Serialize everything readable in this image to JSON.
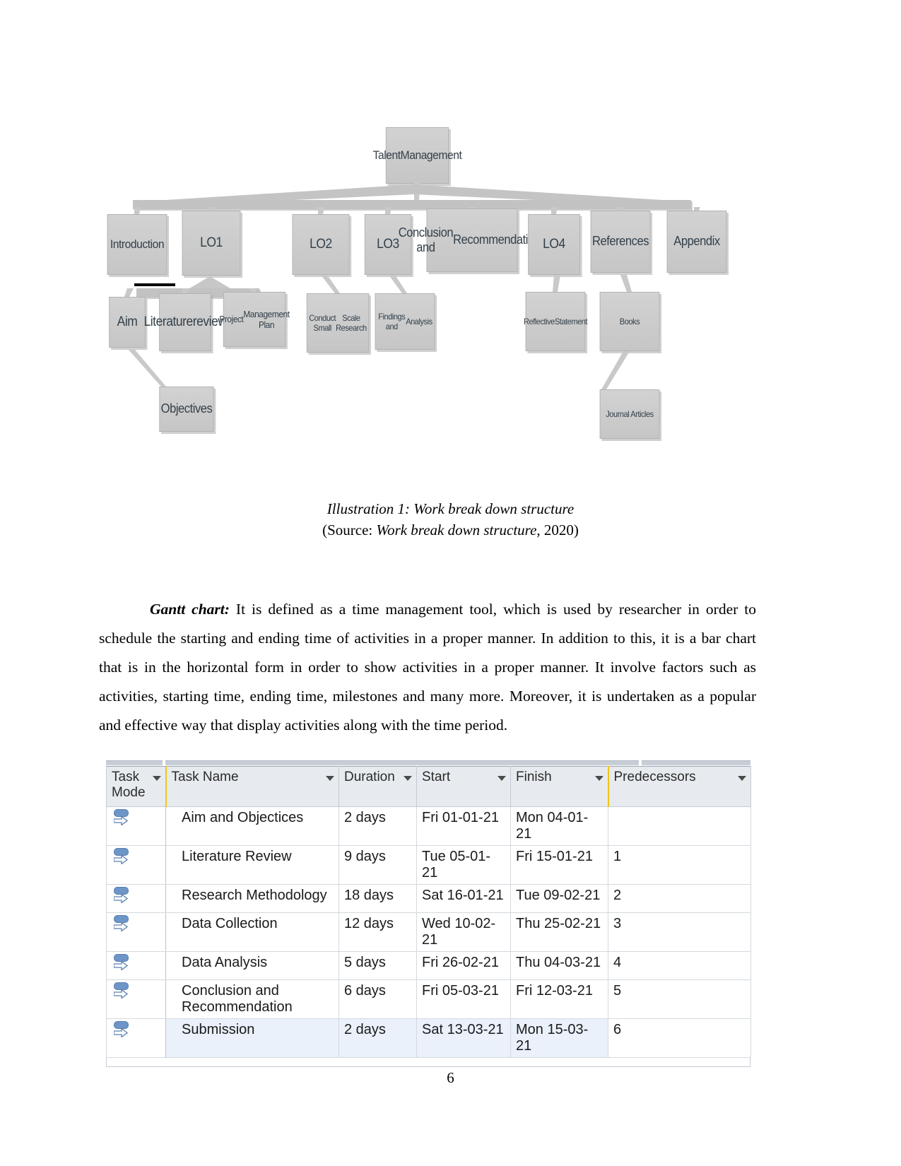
{
  "diagram": {
    "title": "Work break down structure",
    "root": {
      "label": "Talent\nManagement"
    },
    "level1": [
      {
        "label": "Introduction"
      },
      {
        "label": "LO1"
      },
      {
        "label": "LO2"
      },
      {
        "label": "LO3"
      },
      {
        "label": "Conclusion and\nRecommendations"
      },
      {
        "label": "LO4"
      },
      {
        "label": "References"
      },
      {
        "label": "Appendix"
      }
    ],
    "level2": [
      {
        "label": "Aim"
      },
      {
        "label": "Literature\nreview"
      },
      {
        "label": "Project\nManagement Plan"
      },
      {
        "label": "Conduct Small\nScale Research"
      },
      {
        "label": "Findings and\nAnalysis"
      },
      {
        "label": "Reflective\nStatement"
      },
      {
        "label": "Books"
      }
    ],
    "level3": [
      {
        "label": "Objectives"
      },
      {
        "label": "Journal Articles"
      }
    ],
    "node_fill": "#cbcbcb",
    "node_text_color": "#33404a"
  },
  "captions": {
    "illustration": "Illustration 1: Work break down structure",
    "source_prefix": "(Source:  ",
    "source_italic": "Work break down structure",
    "source_suffix": ", 2020)"
  },
  "paragraph": {
    "lead": "Gantt chart:",
    "text": " It is defined as a time management tool, which is used by researcher in order to schedule the starting and ending time of activities in a proper manner. In addition to this, it is a bar chart that is in the horizontal form in order to show activities in a proper manner. It involve factors such as activities, starting time, ending time, milestones and many more. Moreover, it is undertaken as a popular and effective way that display activities along with the time period."
  },
  "table": {
    "columns": [
      {
        "label": "Task\nMode",
        "name": "task-mode"
      },
      {
        "label": "Task Name",
        "name": "task-name"
      },
      {
        "label": "Duration",
        "name": "duration"
      },
      {
        "label": "Start",
        "name": "start"
      },
      {
        "label": "Finish",
        "name": "finish"
      },
      {
        "label": "Predecessors",
        "name": "predecessors"
      }
    ],
    "rows": [
      {
        "task_mode_icon": "auto-scheduled-icon",
        "task_name": "Aim and Objectices",
        "duration": "2 days",
        "start": "Fri 01-01-21",
        "finish": "Mon 04-01-21",
        "predecessors": "",
        "selected": false
      },
      {
        "task_mode_icon": "auto-scheduled-icon",
        "task_name": "Literature Review",
        "duration": "9 days",
        "start": "Tue 05-01-21",
        "finish": "Fri 15-01-21",
        "predecessors": "1",
        "selected": false
      },
      {
        "task_mode_icon": "auto-scheduled-icon",
        "task_name": "Research Methodology",
        "duration": "18 days",
        "start": "Sat 16-01-21",
        "finish": "Tue 09-02-21",
        "predecessors": "2",
        "selected": false
      },
      {
        "task_mode_icon": "auto-scheduled-icon",
        "task_name": "Data Collection",
        "duration": "12 days",
        "start": "Wed 10-02-21",
        "finish": "Thu 25-02-21",
        "predecessors": "3",
        "selected": false
      },
      {
        "task_mode_icon": "auto-scheduled-icon",
        "task_name": "Data Analysis",
        "duration": "5 days",
        "start": "Fri 26-02-21",
        "finish": "Thu 04-03-21",
        "predecessors": "4",
        "selected": false
      },
      {
        "task_mode_icon": "auto-scheduled-icon",
        "task_name": "Conclusion and Recommendation",
        "duration": "6 days",
        "start": "Fri 05-03-21",
        "finish": "Fri 12-03-21",
        "predecessors": "5",
        "selected": false
      },
      {
        "task_mode_icon": "auto-scheduled-icon",
        "task_name": "Submission",
        "duration": "2 days",
        "start": "Sat 13-03-21",
        "finish": "Mon 15-03-21",
        "predecessors": "6",
        "selected": true
      }
    ],
    "header_background": "#e7ebef",
    "selection_background": "#eaf1fb",
    "accent_divider": "#f0c419"
  },
  "page_number": "6"
}
